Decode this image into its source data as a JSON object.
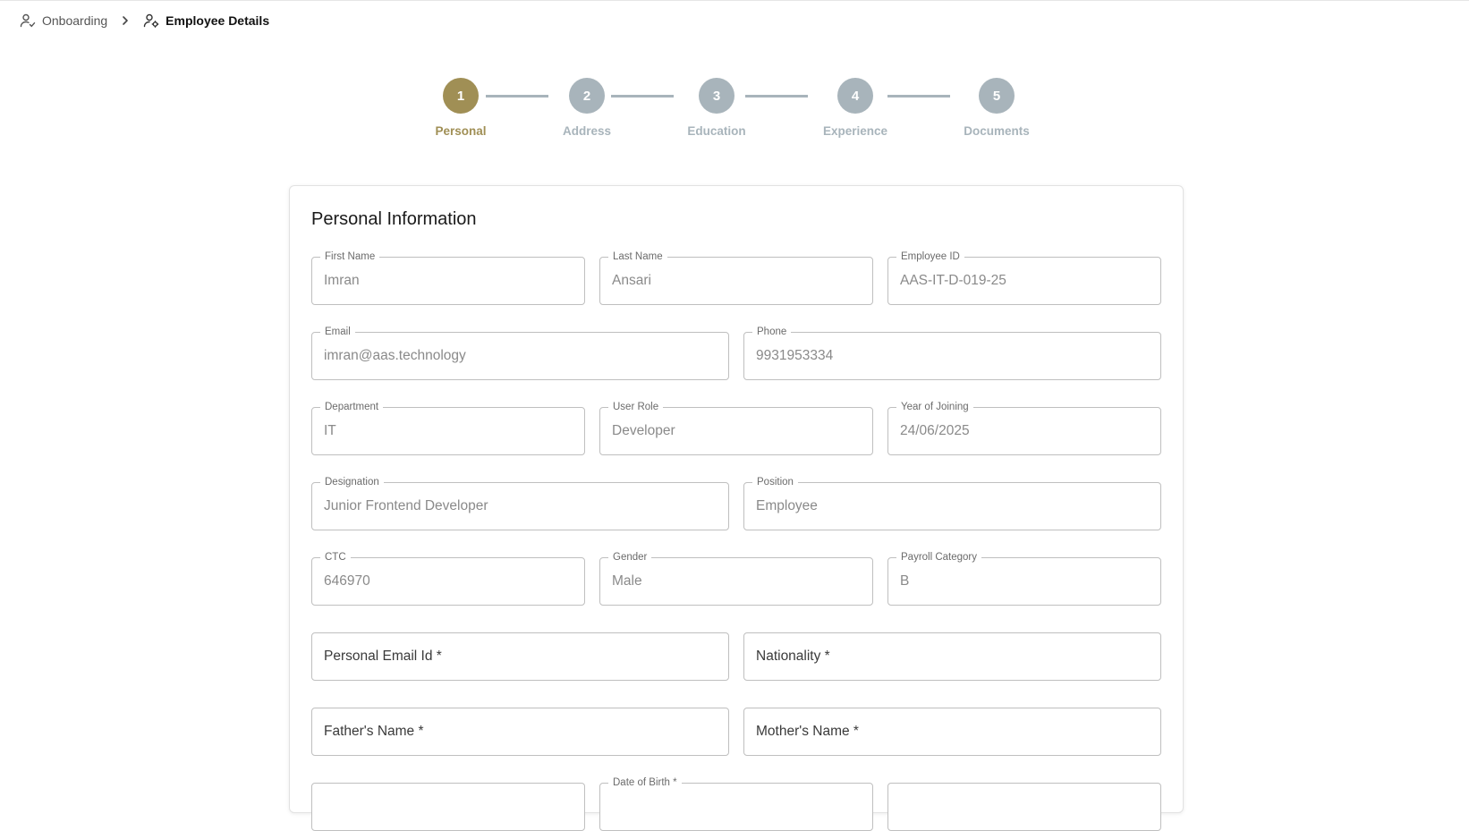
{
  "breadcrumb": {
    "items": [
      {
        "label": "Onboarding",
        "icon": "user-check-icon"
      },
      {
        "label": "Employee Details",
        "icon": "user-settings-icon"
      }
    ],
    "separator_icon": "chevron-right-icon"
  },
  "stepper": {
    "active_color": "#a08f55",
    "inactive_color": "#a8b4bb",
    "steps": [
      {
        "number": "1",
        "label": "Personal",
        "active": true
      },
      {
        "number": "2",
        "label": "Address",
        "active": false
      },
      {
        "number": "3",
        "label": "Education",
        "active": false
      },
      {
        "number": "4",
        "label": "Experience",
        "active": false
      },
      {
        "number": "5",
        "label": "Documents",
        "active": false
      }
    ]
  },
  "form": {
    "title": "Personal Information",
    "first_name": {
      "label": "First Name",
      "value": "Imran"
    },
    "last_name": {
      "label": "Last Name",
      "value": "Ansari"
    },
    "employee_id": {
      "label": "Employee ID",
      "value": "AAS-IT-D-019-25"
    },
    "email": {
      "label": "Email",
      "value": "imran@aas.technology"
    },
    "phone": {
      "label": "Phone",
      "value": "9931953334"
    },
    "department": {
      "label": "Department",
      "value": "IT"
    },
    "user_role": {
      "label": "User Role",
      "value": "Developer"
    },
    "year_of_joining": {
      "label": "Year of Joining",
      "value": "24/06/2025"
    },
    "designation": {
      "label": "Designation",
      "value": "Junior Frontend Developer"
    },
    "position": {
      "label": "Position",
      "value": "Employee"
    },
    "ctc": {
      "label": "CTC",
      "value": "646970"
    },
    "gender": {
      "label": "Gender",
      "value": "Male"
    },
    "payroll_category": {
      "label": "Payroll Category",
      "value": "B"
    },
    "personal_email": {
      "placeholder": "Personal Email Id *"
    },
    "nationality": {
      "placeholder": "Nationality *"
    },
    "fathers_name": {
      "placeholder": "Father's Name *"
    },
    "mothers_name": {
      "placeholder": "Mother's Name *"
    },
    "date_of_birth": {
      "label": "Date of Birth *"
    }
  }
}
